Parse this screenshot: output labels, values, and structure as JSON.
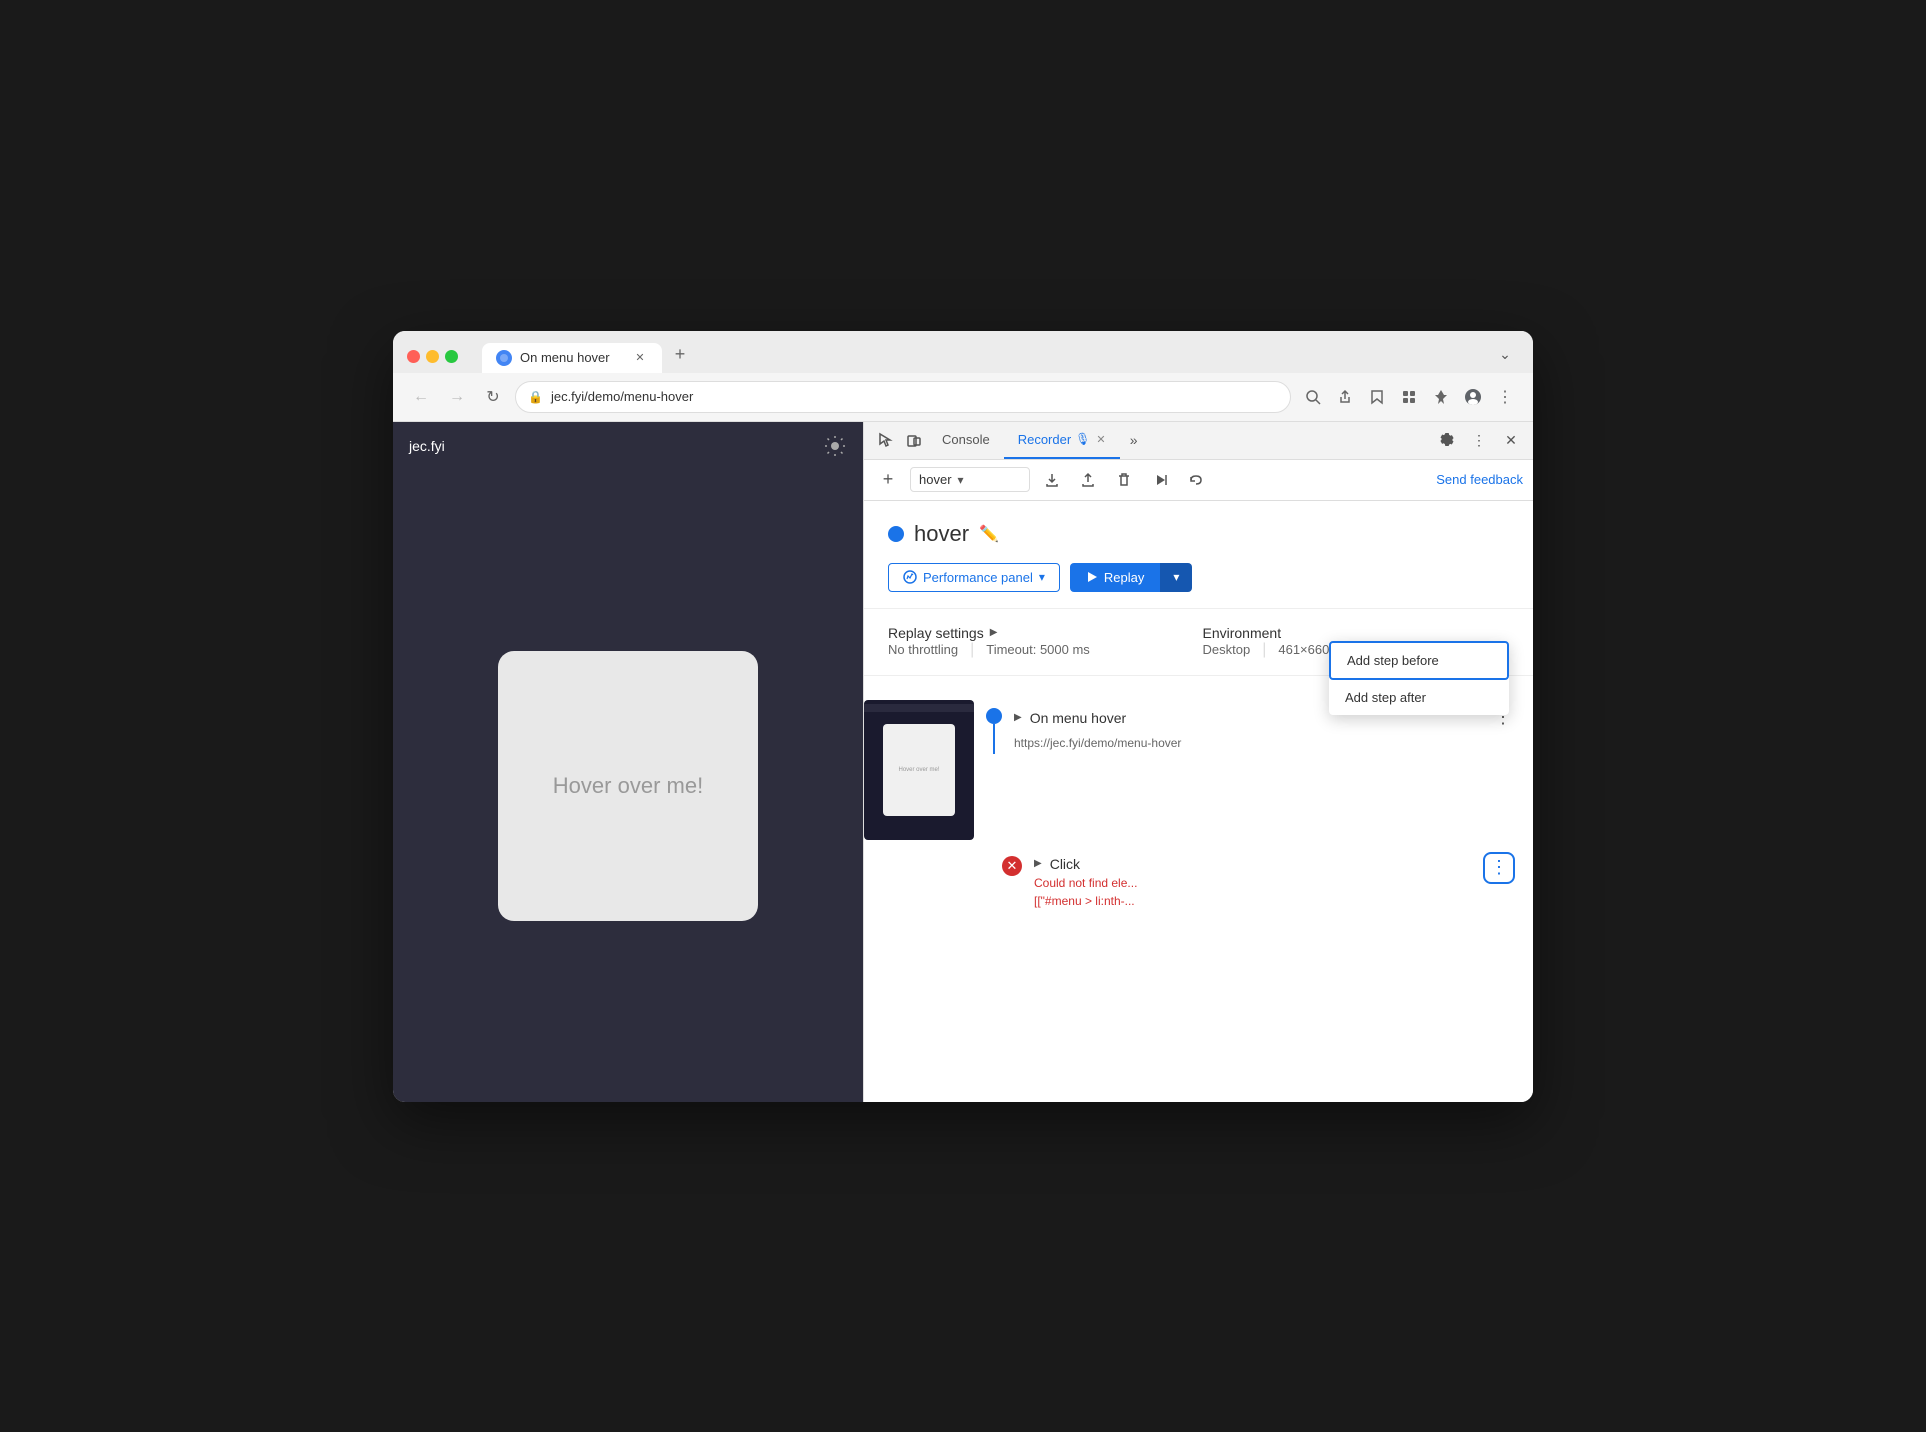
{
  "window": {
    "title": "On menu hover"
  },
  "tabs": [
    {
      "favicon": "🔵",
      "title": "On menu hover",
      "active": true
    }
  ],
  "addressBar": {
    "url": "jec.fyi/demo/menu-hover",
    "lock_icon": "🔒"
  },
  "webpage": {
    "title": "jec.fyi",
    "hover_text": "Hover over me!"
  },
  "devtools": {
    "tabs": [
      {
        "label": "Console",
        "active": false
      },
      {
        "label": "Recorder",
        "active": true
      },
      {
        "label": "×",
        "active": false
      }
    ],
    "toolbar": {
      "recording_name": "hover",
      "send_feedback": "Send feedback"
    },
    "recording": {
      "name": "hover",
      "dot_color": "#1a73e8"
    },
    "buttons": {
      "performance_panel": "Performance panel",
      "replay": "Replay"
    },
    "settings": {
      "title": "Replay settings",
      "arrow": "▶",
      "throttling": "No throttling",
      "timeout_label": "Timeout: 5000 ms",
      "environment_title": "Environment",
      "desktop": "Desktop",
      "resolution": "461×660 px"
    },
    "steps": [
      {
        "title": "On menu hover",
        "url": "https://jec.fyi/demo/menu-hover",
        "type": "header",
        "status": "ok"
      },
      {
        "title": "Click",
        "type": "step",
        "status": "error",
        "error_text": "Could not find ele...",
        "error_detail": "[[\"#menu > li:nth-..."
      }
    ]
  },
  "context_menu": {
    "items": [
      {
        "label": "Add step before",
        "highlighted": true
      },
      {
        "label": "Add step after",
        "highlighted": false
      }
    ]
  }
}
